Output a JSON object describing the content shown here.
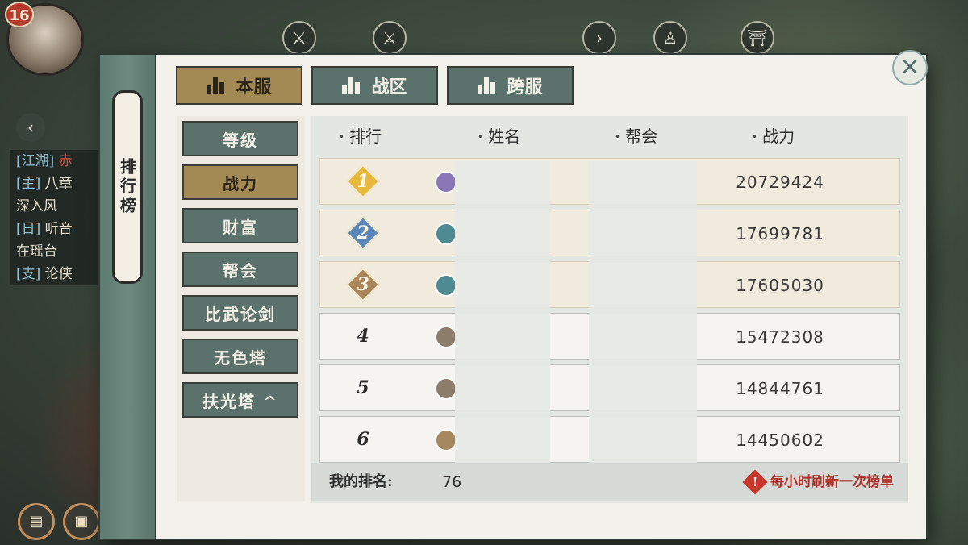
{
  "hud": {
    "player_level": "16",
    "quest_lines": [
      {
        "tag": "[江湖]",
        "text": " 赤",
        "red": true
      },
      {
        "tag": "[主]",
        "text": " 八章",
        "red": false
      },
      {
        "tag": "",
        "text": "深入风",
        "red": false
      },
      {
        "tag": "[日]",
        "text": " 听音",
        "red": false
      },
      {
        "tag": "",
        "text": "在瑶台",
        "red": false
      },
      {
        "tag": "[支]",
        "text": " 论侠",
        "red": false
      }
    ]
  },
  "panel": {
    "title": "排行榜",
    "close_icon": "×"
  },
  "server_tabs": [
    {
      "label": "本服",
      "active": true
    },
    {
      "label": "战区",
      "active": false
    },
    {
      "label": "跨服",
      "active": false
    }
  ],
  "categories": [
    {
      "label": "等级",
      "active": false
    },
    {
      "label": "战力",
      "active": true
    },
    {
      "label": "财富",
      "active": false
    },
    {
      "label": "帮会",
      "active": false
    },
    {
      "label": "比武论剑",
      "active": false
    },
    {
      "label": "无色塔",
      "active": false
    },
    {
      "label": "扶光塔 ^",
      "active": false
    }
  ],
  "table": {
    "headers": {
      "rank": "排行",
      "name": "姓名",
      "guild": "帮会",
      "power": "战力"
    },
    "rows": [
      {
        "rank": "1",
        "badge_color": "#e7b83c",
        "emblem_color": "#8a77b7",
        "power": "20729424"
      },
      {
        "rank": "2",
        "badge_color": "#5b86b8",
        "emblem_color": "#4f8a92",
        "power": "17699781"
      },
      {
        "rank": "3",
        "badge_color": "#a8865a",
        "emblem_color": "#4f8a92",
        "power": "17605030"
      },
      {
        "rank": "4",
        "badge_color": "",
        "emblem_color": "#8b7d6a",
        "power": "15472308"
      },
      {
        "rank": "5",
        "badge_color": "",
        "emblem_color": "#8b7d6a",
        "power": "14844761"
      },
      {
        "rank": "6",
        "badge_color": "",
        "emblem_color": "#a8895f",
        "power": "14450602"
      }
    ]
  },
  "footer": {
    "my_rank_label": "我的排名:",
    "my_rank_value": "76",
    "refresh_note": "每小时刷新一次榜单",
    "warn_icon": "!"
  },
  "colors": {
    "active_tab": "#a38a55",
    "inactive_tab": "#5b716b",
    "panel_bg": "#f3f1ec",
    "note_red": "#b0302a"
  }
}
